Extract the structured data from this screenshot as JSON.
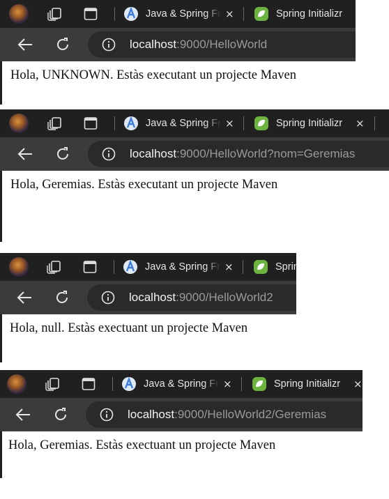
{
  "shots": [
    {
      "tabs": [
        {
          "label": "Java & Spring Fr",
          "icon": "a-letter-icon"
        },
        {
          "label": "Spring Initializr",
          "icon": "spring-leaf-icon"
        }
      ],
      "url_host": "localhost",
      "url_path": ":9000/HelloWorld",
      "page_text": "Hola, UNKNOWN. Estàs executant un projecte Maven"
    },
    {
      "tabs": [
        {
          "label": "Java & Spring Fr",
          "icon": "a-letter-icon"
        },
        {
          "label": "Spring Initializr",
          "icon": "spring-leaf-icon"
        }
      ],
      "url_host": "localhost",
      "url_path": ":9000/HelloWorld?nom=Geremias",
      "page_text": "Hola, Geremias. Estàs executant un projecte Maven"
    },
    {
      "tabs": [
        {
          "label": "Java & Spring Fr",
          "icon": "a-letter-icon"
        },
        {
          "label": "Sprin",
          "icon": "spring-leaf-icon"
        }
      ],
      "url_host": "localhost",
      "url_path": ":9000/HelloWorld2",
      "page_text": "Hola, null. Estàs exectuant un projecte Maven"
    },
    {
      "tabs": [
        {
          "label": "Java & Spring Fr",
          "icon": "a-letter-icon"
        },
        {
          "label": "Spring Initializr",
          "icon": "spring-leaf-icon"
        }
      ],
      "url_host": "localhost",
      "url_path": ":9000/HelloWorld2/Geremias",
      "page_text": "Hola, Geremias. Estàs exectuant un projecte Maven"
    }
  ],
  "icons": {
    "close": "×",
    "back": "back-arrow-icon",
    "reload": "reload-icon",
    "info": "info-icon",
    "workspaces": "workspaces-icon",
    "tab_actions": "vertical-tabs-icon"
  },
  "colors": {
    "tabbar": "#202020",
    "addrbar": "#3b3b3b",
    "url_pill": "#2a2a2a",
    "spring_green": "#6db33f",
    "a_icon_blue": "#3b7dd8"
  }
}
